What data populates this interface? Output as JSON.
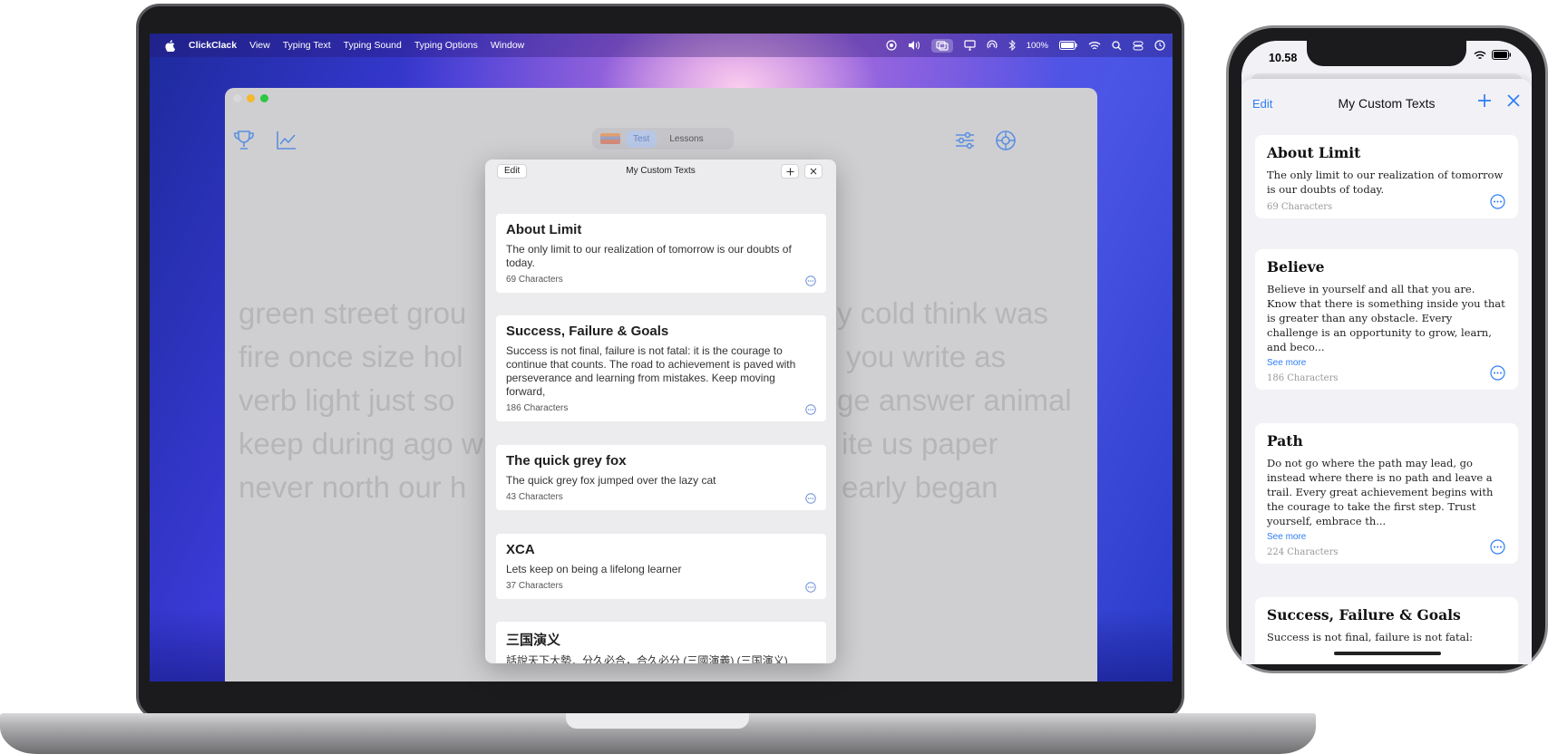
{
  "menubar": {
    "app_name": "ClickClack",
    "items": [
      "View",
      "Typing Text",
      "Typing Sound",
      "Typing Options",
      "Window"
    ],
    "battery": "100%"
  },
  "app": {
    "segment": {
      "test_label": "Test",
      "lessons_label": "Lessons"
    },
    "typing_lines_left": [
      "green street grou",
      "fire once size hol",
      "verb light just so",
      "keep during ago w",
      "never north our h"
    ],
    "typing_lines_right": [
      "y cold think was",
      "you write as",
      "ge answer animal",
      "ite us paper",
      "early began"
    ]
  },
  "mac_sheet": {
    "edit_label": "Edit",
    "title": "My Custom Texts",
    "add_label": "+",
    "cards": [
      {
        "title": "About Limit",
        "body": "The only limit to our realization of tomorrow is our doubts of today.",
        "count": "69 Characters"
      },
      {
        "title": "Success, Failure & Goals",
        "body": "Success is not final, failure is not fatal: it is the courage to continue that counts. The road to achievement is paved with perseverance and learning from mistakes. Keep moving forward,",
        "count": "186 Characters"
      },
      {
        "title": "The quick grey fox",
        "body": "The quick grey fox jumped over the lazy cat",
        "count": "43 Characters"
      },
      {
        "title": "XCA",
        "body": "Lets keep on being a lifelong learner",
        "count": "37 Characters"
      },
      {
        "title": "三国演义",
        "body": "話說天下大勢．分久必合，合久必分 (三國演義) (三国演义)",
        "count": ""
      }
    ]
  },
  "phone": {
    "time": "10.58",
    "edit_label": "Edit",
    "title": "My Custom Texts",
    "see_more_label": "See more",
    "cards": [
      {
        "title": "About Limit",
        "body": "The only limit to our realization of tomorrow is our doubts of today.",
        "count": "69 Characters"
      },
      {
        "title": "Believe",
        "body": "Believe in yourself and all that you are. Know that there is something inside you that is greater than any obstacle. Every challenge is an opportunity to grow, learn, and beco...",
        "count": "186 Characters"
      },
      {
        "title": "Path",
        "body": "Do not go where the path may lead, go instead where there is no path and leave a trail. Every great achievement begins with the courage to take the first step. Trust yourself, embrace th...",
        "count": "224 Characters"
      },
      {
        "title": "Success, Failure & Goals",
        "body": "Success is not final, failure is not fatal:",
        "count": ""
      }
    ]
  },
  "colors": {
    "accent": "#2f7df6",
    "window_gray": "#cfcfd2",
    "sheet_bg": "#ececee"
  }
}
